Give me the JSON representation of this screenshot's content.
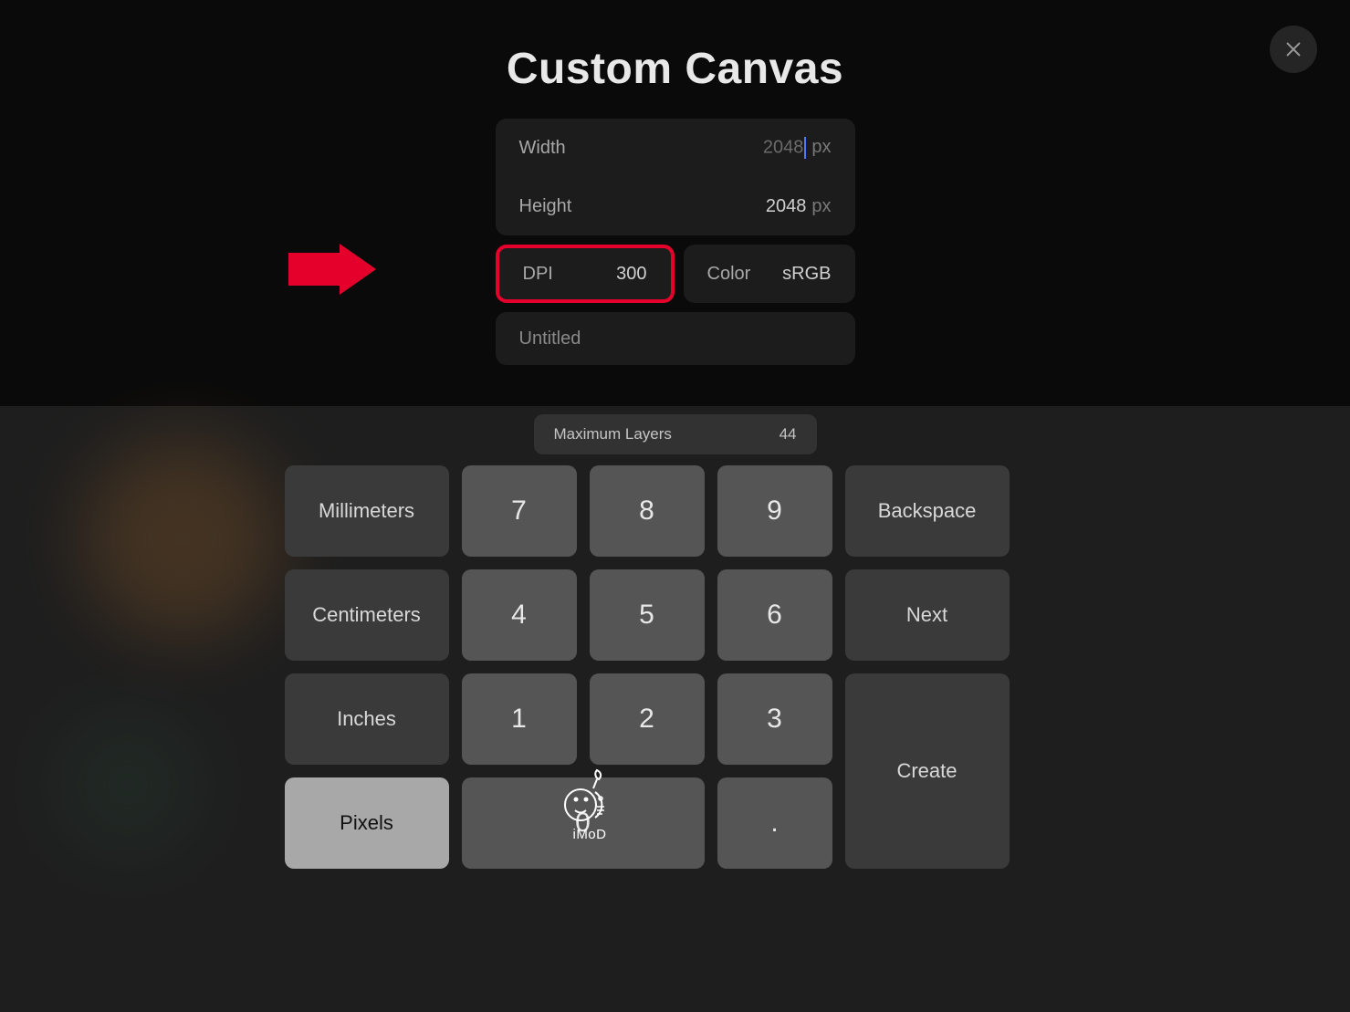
{
  "header": {
    "title": "Custom Canvas"
  },
  "fields": {
    "width": {
      "label": "Width",
      "value": "2048",
      "unit": "px"
    },
    "height": {
      "label": "Height",
      "value": "2048",
      "unit": "px"
    },
    "dpi": {
      "label": "DPI",
      "value": "300"
    },
    "color": {
      "label": "Color",
      "value": "sRGB"
    },
    "name": {
      "placeholder": "Untitled"
    }
  },
  "maxlayers": {
    "label": "Maximum Layers",
    "value": "44"
  },
  "keypad": {
    "units": [
      "Millimeters",
      "Centimeters",
      "Inches",
      "Pixels"
    ],
    "nums": {
      "k7": "7",
      "k8": "8",
      "k9": "9",
      "k4": "4",
      "k5": "5",
      "k6": "6",
      "k1": "1",
      "k2": "2",
      "k3": "3",
      "k0": "0",
      "kdot": "."
    },
    "actions": {
      "backspace": "Backspace",
      "next": "Next",
      "create": "Create"
    }
  },
  "watermark": {
    "text": "iMoD"
  },
  "colors": {
    "accent": "#e4002b",
    "highlight_border": "#e4002b"
  }
}
